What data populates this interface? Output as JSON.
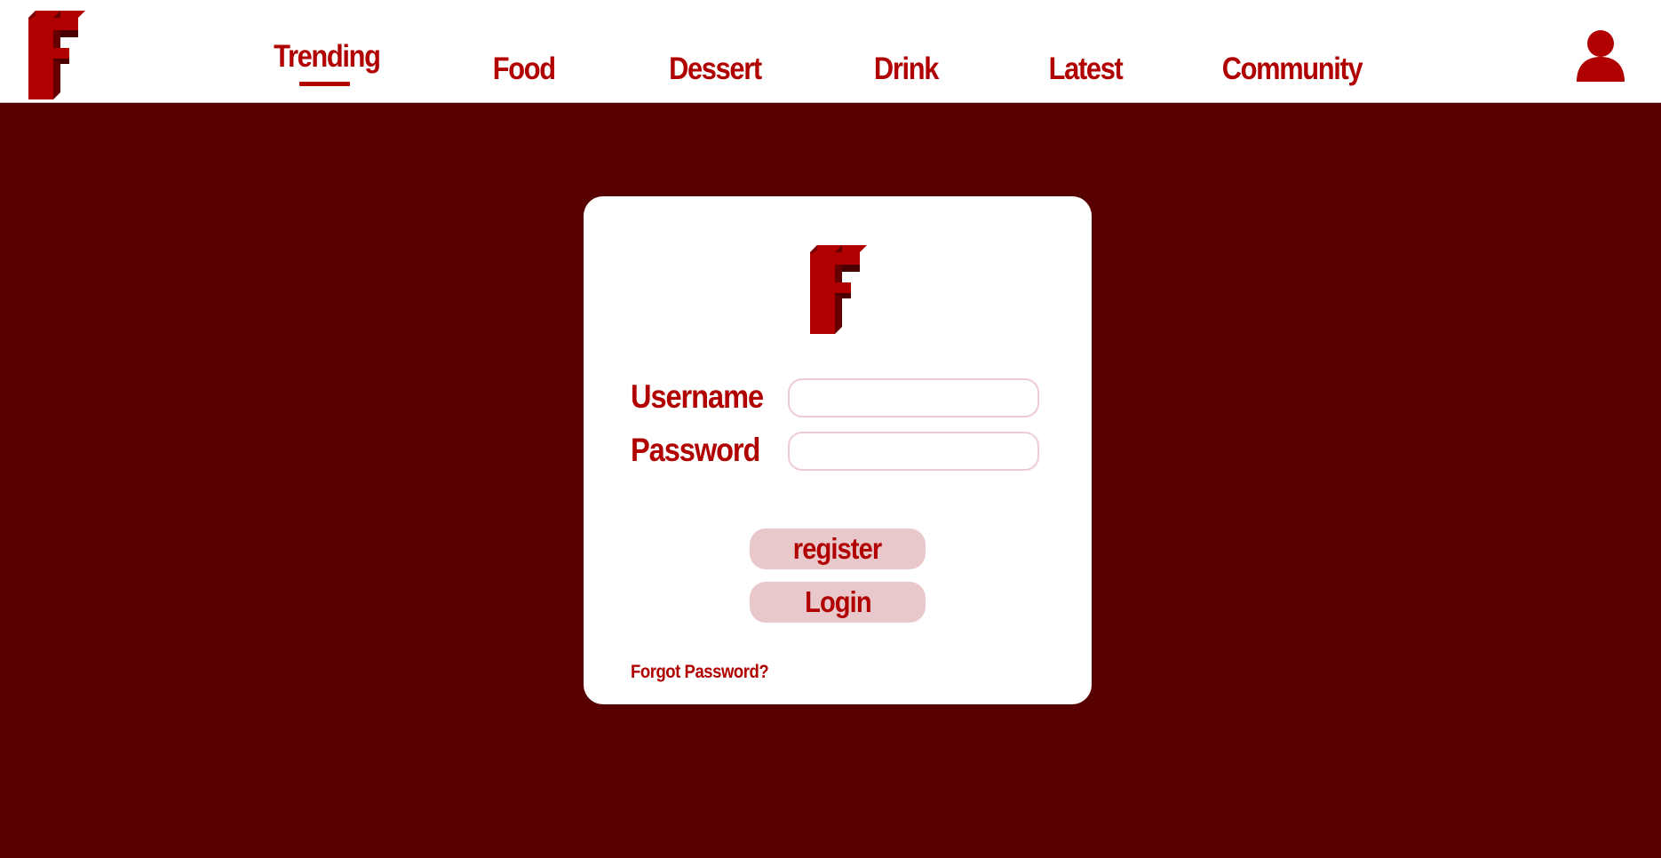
{
  "colors": {
    "brand_red": "#b00000",
    "background": "#580000",
    "button_fill": "#e9c8cc",
    "input_border": "#efcbd3"
  },
  "nav": {
    "logo_icon": "f-logo",
    "items": [
      {
        "label": "Trending",
        "active": true
      },
      {
        "label": "Food"
      },
      {
        "label": "Dessert"
      },
      {
        "label": "Drink"
      },
      {
        "label": "Latest"
      },
      {
        "label": "Community"
      }
    ],
    "user_icon": "user-icon"
  },
  "login": {
    "logo_icon": "f-logo",
    "username_label": "Username",
    "username_value": "",
    "password_label": "Password",
    "password_value": "",
    "register_label": "register",
    "login_label": "Login",
    "forgot_label": "Forgot Password?"
  }
}
